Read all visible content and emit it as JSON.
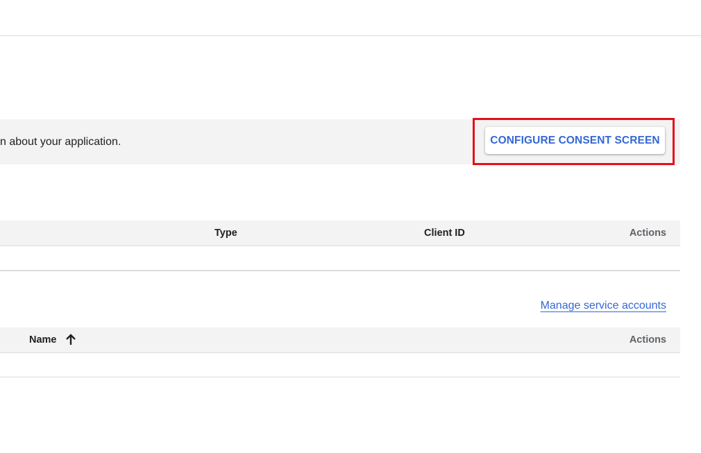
{
  "consent_banner": {
    "text": "n about your application.",
    "button_label": "CONFIGURE CONSENT SCREEN"
  },
  "oauth_table": {
    "columns": {
      "type": "Type",
      "client_id": "Client ID",
      "actions": "Actions"
    }
  },
  "service_accounts": {
    "manage_link": "Manage service accounts",
    "columns": {
      "name": "Name",
      "actions": "Actions"
    },
    "sort_icon": "arrow-up-icon"
  },
  "colors": {
    "accent": "#3367d6",
    "highlight": "#e3101a",
    "header_bg": "#f3f3f3"
  }
}
